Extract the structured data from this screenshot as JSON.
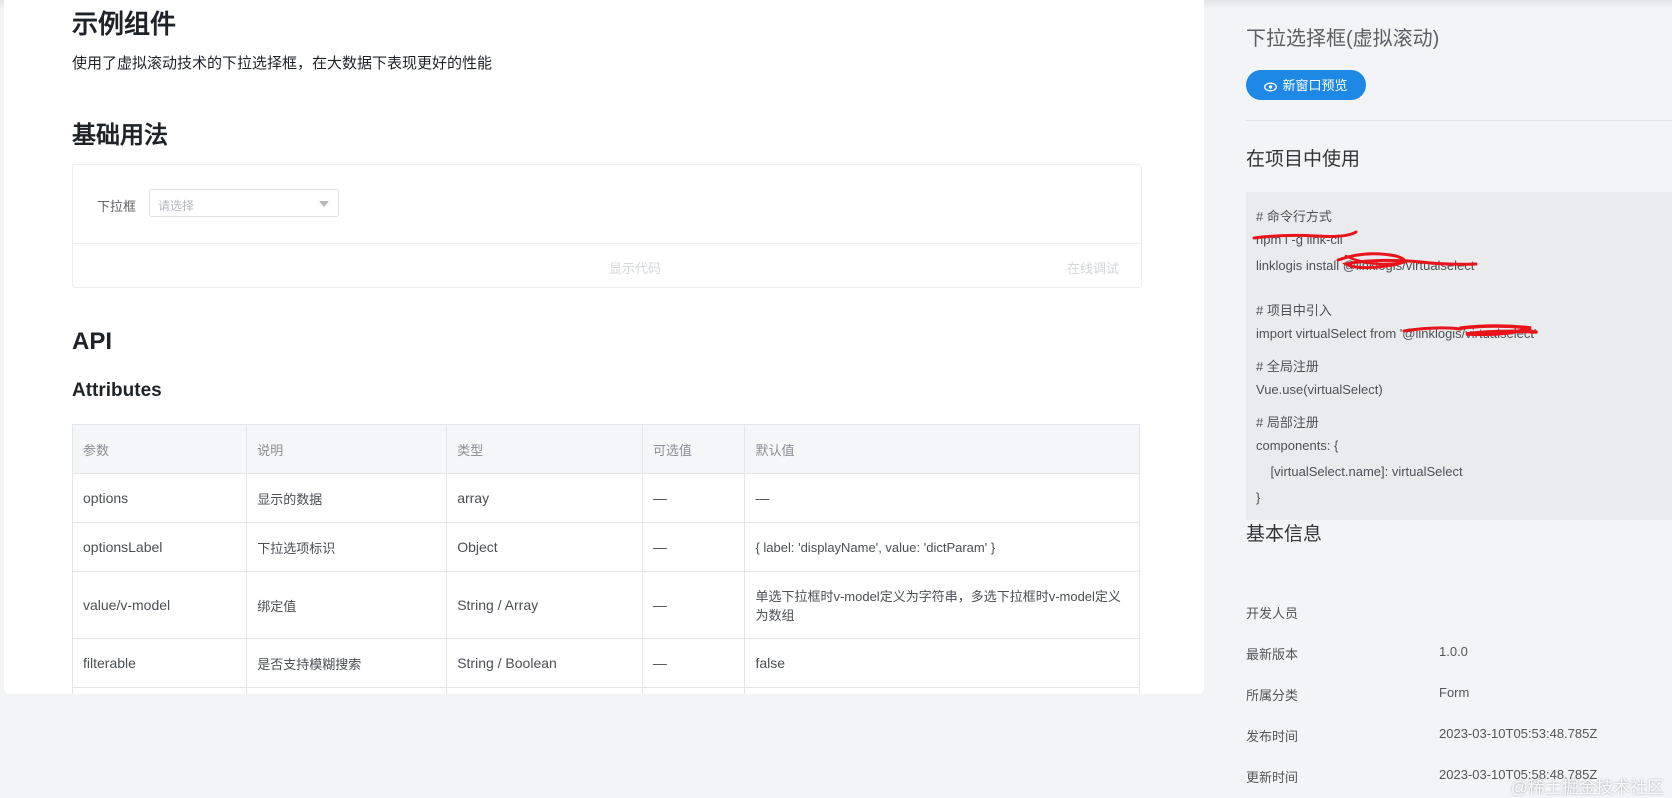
{
  "main": {
    "title": "示例组件",
    "description": "使用了虚拟滚动技术的下拉选择框，在大数据下表现更好的性能",
    "basic_usage_heading": "基础用法",
    "demo": {
      "select_label": "下拉框",
      "select_placeholder": "请选择",
      "show_code": "显示代码",
      "online_debug": "在线调试"
    },
    "api_heading": "API",
    "attributes_heading": "Attributes",
    "table": {
      "headers": [
        "参数",
        "说明",
        "类型",
        "可选值",
        "默认值"
      ],
      "rows": [
        [
          "options",
          "显示的数据",
          "array",
          "—",
          "—"
        ],
        [
          "optionsLabel",
          "下拉选项标识",
          "Object",
          "—",
          "{ label: 'displayName', value: 'dictParam' }"
        ],
        [
          "value/v-model",
          "绑定值",
          "String / Array",
          "—",
          "单选下拉框时v-model定义为字符串，多选下拉框时v-model定义为数组"
        ],
        [
          "filterable",
          "是否支持模糊搜索",
          "String / Boolean",
          "—",
          "false"
        ]
      ]
    }
  },
  "side": {
    "title": "下拉选择框(虚拟滚动)",
    "preview_button": "新窗口预览",
    "use_in_project_heading": "在项目中使用",
    "code_lines": [
      "# 命令行方式",
      "npm i -g link-cli",
      "linklogis install @linklogis/virtualselect",
      "# 项目中引入",
      "import virtualSelect from '@linklogis/virtualselect'",
      "# 全局注册",
      "Vue.use(virtualSelect)",
      "# 局部注册",
      "components: {",
      "    [virtualSelect.name]: virtualSelect",
      "}"
    ],
    "basic_info_heading": "基本信息",
    "info": [
      {
        "label": "开发人员",
        "value": ""
      },
      {
        "label": "最新版本",
        "value": "1.0.0"
      },
      {
        "label": "所属分类",
        "value": "Form"
      },
      {
        "label": "发布时间",
        "value": "2023-03-10T05:53:48.785Z"
      },
      {
        "label": "更新时间",
        "value": "2023-03-10T05:58:48.785Z"
      }
    ]
  },
  "watermark": "@稀土掘金技术社区",
  "colors": {
    "accent": "#1e88e5",
    "scribble": "#e8141a"
  }
}
